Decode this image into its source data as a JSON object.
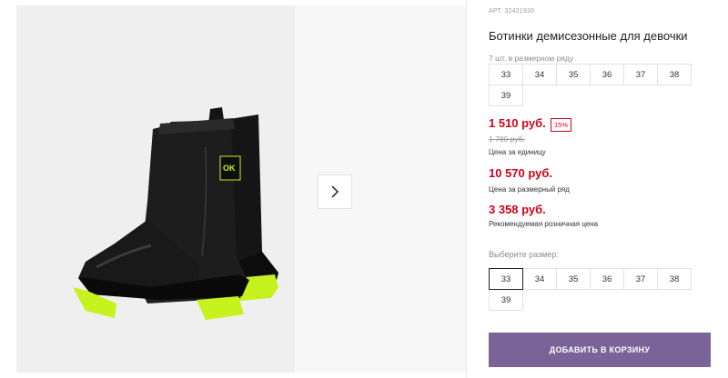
{
  "product": {
    "sku": "АРТ. 32421920",
    "title": "Ботинки демисезонные для девочки",
    "pack_count_label": "7 шт. в размерном ряду",
    "pack_sizes": [
      "33",
      "34",
      "35",
      "36",
      "37",
      "38",
      "39"
    ],
    "price_unit": "1 510 руб.",
    "discount_badge": "15%",
    "price_old": "1 780 руб.",
    "price_unit_label": "Цена за единицу",
    "price_pack": "10 570 руб.",
    "price_pack_label": "Цена за размерный ряд",
    "price_retail": "3 358 руб.",
    "price_retail_label": "Рекомендуемая розничная цена",
    "choose_size_label": "Выберите размер:",
    "choose_sizes": [
      "33",
      "34",
      "35",
      "36",
      "37",
      "38",
      "39"
    ],
    "selected_size": "33",
    "add_to_cart_label": "ДОБАВИТЬ В КОРЗИНУ"
  },
  "gallery": {
    "next_icon": "chevron-right-icon"
  },
  "colors": {
    "price_red": "#d0021b",
    "button_purple": "#7a6396",
    "sole_lime": "#c6f21d"
  }
}
